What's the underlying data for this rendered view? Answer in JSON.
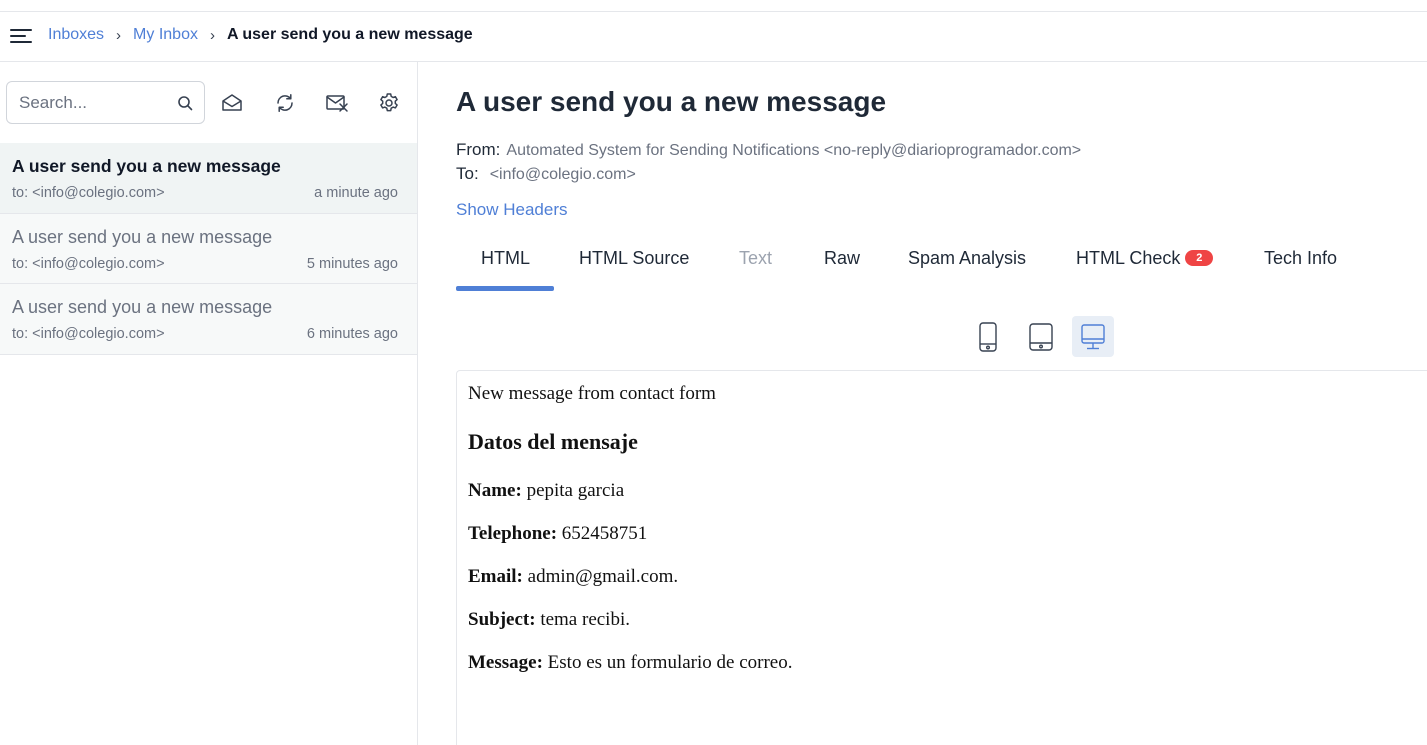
{
  "breadcrumb": {
    "items": [
      "Inboxes",
      "My Inbox"
    ],
    "separator": "›",
    "current": "A user send you a new message"
  },
  "sidebar": {
    "search_placeholder": "Search...",
    "messages": [
      {
        "subject": "A user send you a new message",
        "to": "to: <info@colegio.com>",
        "time": "a minute ago",
        "active": true
      },
      {
        "subject": "A user send you a new message",
        "to": "to: <info@colegio.com>",
        "time": "5 minutes ago",
        "active": false
      },
      {
        "subject": "A user send you a new message",
        "to": "to: <info@colegio.com>",
        "time": "6 minutes ago",
        "active": false
      }
    ]
  },
  "message": {
    "title": "A user send you a new message",
    "from_label": "From:",
    "from_value": "Automated System for Sending Notifications <no-reply@diarioprogramador.com>",
    "to_label": "To:",
    "to_value": "<info@colegio.com>",
    "show_headers": "Show Headers"
  },
  "tabs": [
    {
      "label": "HTML",
      "active": true
    },
    {
      "label": "HTML Source"
    },
    {
      "label": "Text",
      "disabled": true
    },
    {
      "label": "Raw"
    },
    {
      "label": "Spam Analysis"
    },
    {
      "label": "HTML Check",
      "badge": "2"
    },
    {
      "label": "Tech Info"
    }
  ],
  "devices": {
    "selected": "desktop",
    "icons": [
      "mobile-icon",
      "tablet-icon",
      "desktop-icon"
    ]
  },
  "body": {
    "intro": "New message from contact form",
    "heading": "Datos del mensaje",
    "fields": [
      {
        "label": "Name:",
        "value": "pepita garcia"
      },
      {
        "label": "Telephone:",
        "value": "652458751"
      },
      {
        "label": "Email:",
        "value": "admin@gmail.com."
      },
      {
        "label": "Subject:",
        "value": "tema recibi."
      },
      {
        "label": "Message:",
        "value": "Esto es un formulario de correo."
      }
    ]
  },
  "colors": {
    "accent": "#4f7fd6",
    "badge": "#ef4444",
    "text": "#1f2937",
    "muted": "#6b7280"
  }
}
